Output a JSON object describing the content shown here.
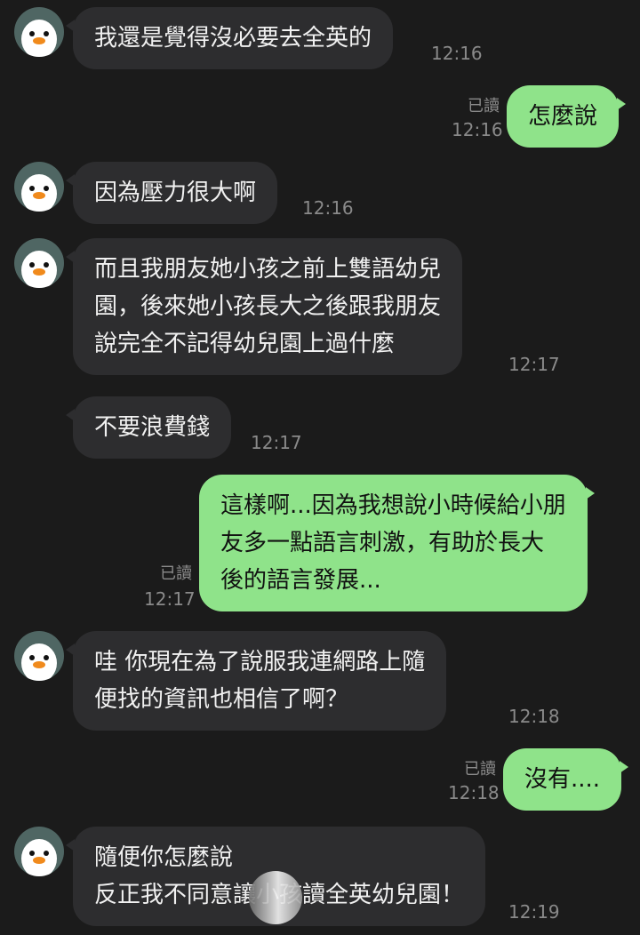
{
  "messages": [
    {
      "side": "in",
      "lines": [
        "我還是覺得沒必要去全英的"
      ],
      "time": "12:16"
    },
    {
      "side": "out",
      "lines": [
        "怎麼說"
      ],
      "time": "12:16",
      "read": "已讀"
    },
    {
      "side": "in",
      "lines": [
        "因為壓力很大啊"
      ],
      "time": "12:16"
    },
    {
      "side": "in",
      "lines": [
        "而且我朋友她小孩之前上雙語幼兒",
        "園，後來她小孩長大之後跟我朋友",
        "說完全不記得幼兒園上過什麼"
      ],
      "time": "12:17"
    },
    {
      "side": "in",
      "lines": [
        "不要浪費錢"
      ],
      "time": "12:17"
    },
    {
      "side": "out",
      "lines": [
        "這樣啊...因為我想說小時候給小朋",
        "友多一點語言刺激，有助於長大",
        "後的語言發展..."
      ],
      "time": "12:17",
      "read": "已讀"
    },
    {
      "side": "in",
      "lines": [
        "哇 你現在為了說服我連網路上隨",
        "便找的資訊也相信了啊？"
      ],
      "time": "12:18"
    },
    {
      "side": "out",
      "lines": [
        "沒有...."
      ],
      "time": "12:18",
      "read": "已讀"
    },
    {
      "side": "in",
      "lines": [
        "隨便你怎麼說",
        "反正我不同意讓小孩讀全英幼兒園！"
      ],
      "time": "12:19"
    }
  ],
  "colors": {
    "background": "#1b1b1b",
    "incoming_bubble": "#2d2d2f",
    "outgoing_bubble": "#8fe38a",
    "avatar_bg": "#4f6663"
  },
  "icons": {
    "avatar": "penguin-icon"
  }
}
